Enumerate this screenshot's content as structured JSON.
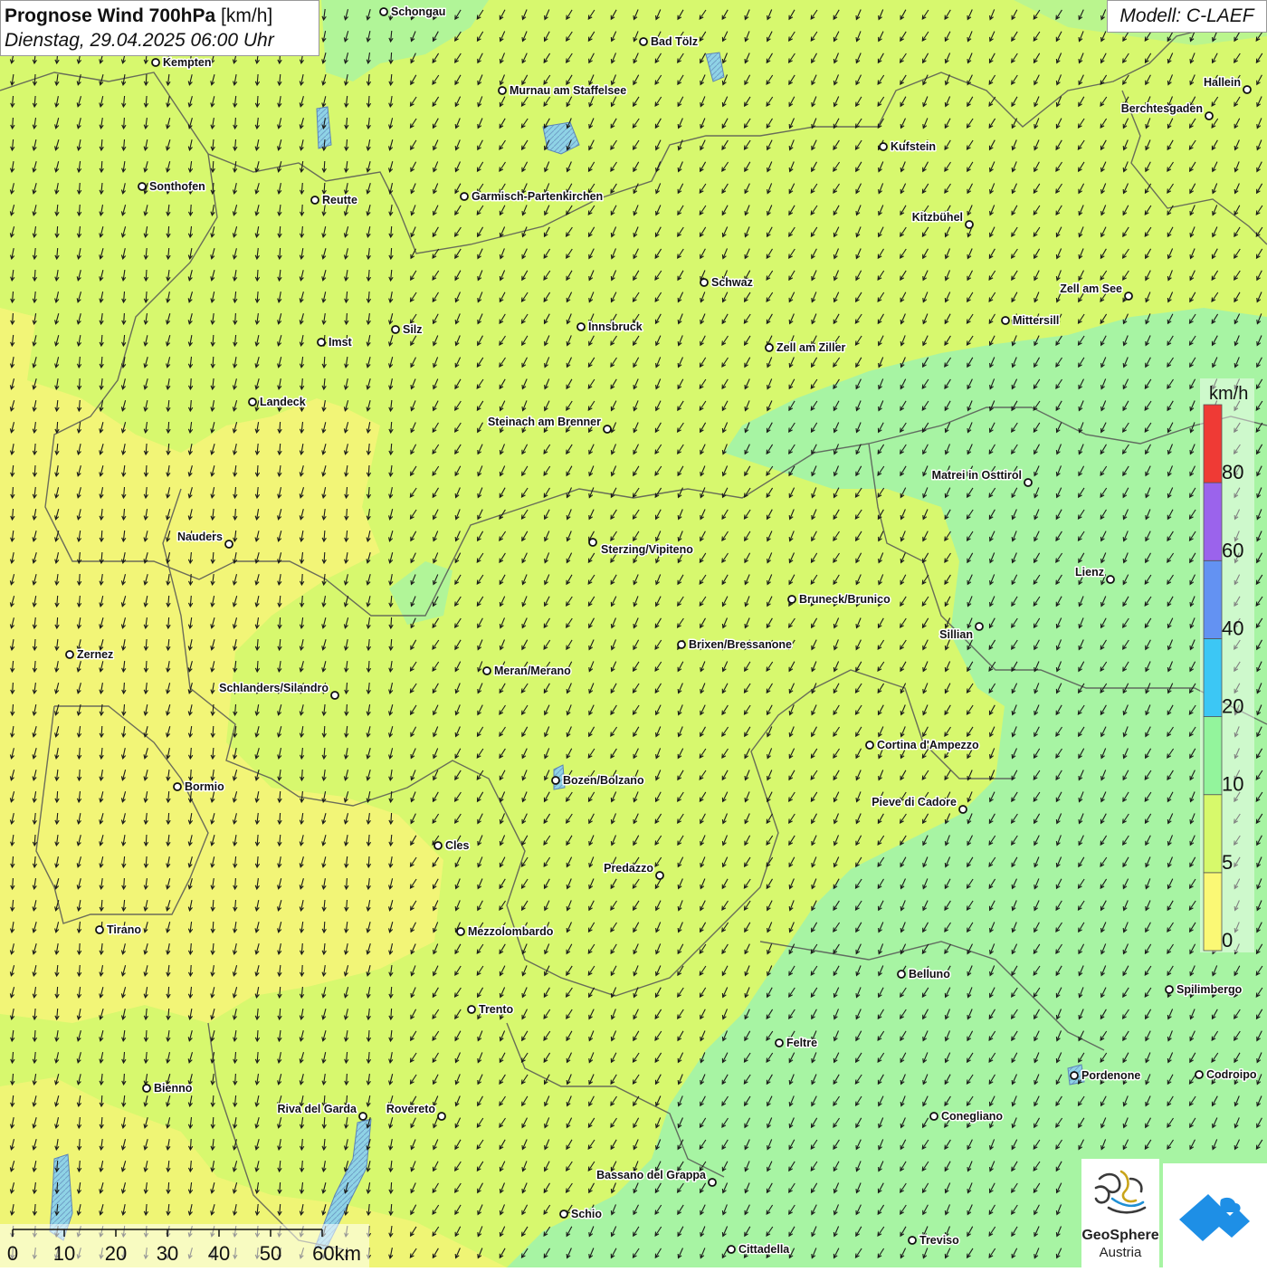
{
  "header": {
    "title": "Prognose Wind 700hPa",
    "unit": "[km/h]",
    "datetime": "Dienstag, 29.04.2025 06:00 Uhr",
    "model": "Modell: C-LAEF"
  },
  "legend": {
    "unit": "km/h",
    "labels": [
      "0",
      "5",
      "10",
      "20",
      "40",
      "60",
      "80"
    ],
    "colors": [
      "#fbf875",
      "#d7f96b",
      "#93f59c",
      "#3cc7f5",
      "#6392f2",
      "#9b63ec",
      "#ef3a35"
    ]
  },
  "colors": {
    "zone_yellow": "#f3f477",
    "zone_lime": "#d7f86e",
    "zone_green": "#a7f4a3",
    "border": "#555555",
    "lake": "#8fd3e6"
  },
  "wind": {
    "direction": "from north-northeast",
    "arrow_icon": "wind-arrow-icon"
  },
  "scalebar": {
    "labels": [
      "0",
      "10",
      "20",
      "30",
      "40",
      "50",
      "60km"
    ]
  },
  "places": [
    {
      "name": "Schongau"
    },
    {
      "name": "Bad Tölz"
    },
    {
      "name": "Kempten"
    },
    {
      "name": "Murnau am Staffelsee"
    },
    {
      "name": "Hallein"
    },
    {
      "name": "Berchtesgaden"
    },
    {
      "name": "Kufstein"
    },
    {
      "name": "Sonthofen"
    },
    {
      "name": "Reutte"
    },
    {
      "name": "Garmisch-Partenkirchen"
    },
    {
      "name": "Kitzbühel"
    },
    {
      "name": "Schwaz"
    },
    {
      "name": "Zell am See"
    },
    {
      "name": "Mittersill"
    },
    {
      "name": "Innsbruck"
    },
    {
      "name": "Silz"
    },
    {
      "name": "Imst"
    },
    {
      "name": "Zell am Ziller"
    },
    {
      "name": "Landeck"
    },
    {
      "name": "Steinach am Brenner"
    },
    {
      "name": "Matrei in Osttirol"
    },
    {
      "name": "Nauders"
    },
    {
      "name": "Sterzing/Vipiteno"
    },
    {
      "name": "Lienz"
    },
    {
      "name": "Bruneck/Brunico"
    },
    {
      "name": "Sillian"
    },
    {
      "name": "Brixen/Bressanone"
    },
    {
      "name": "Zernez"
    },
    {
      "name": "Meran/Merano"
    },
    {
      "name": "Schlanders/Silandro"
    },
    {
      "name": "Cortina d'Ampezzo"
    },
    {
      "name": "Bormio"
    },
    {
      "name": "Bozen/Bolzano"
    },
    {
      "name": "Pieve di Cadore"
    },
    {
      "name": "Cles"
    },
    {
      "name": "Predazzo"
    },
    {
      "name": "Tirano"
    },
    {
      "name": "Mezzolombardo"
    },
    {
      "name": "Belluno"
    },
    {
      "name": "Spilimbergo"
    },
    {
      "name": "Trento"
    },
    {
      "name": "Feltre"
    },
    {
      "name": "Pordenone"
    },
    {
      "name": "Codroipo"
    },
    {
      "name": "Bienno"
    },
    {
      "name": "Riva del Garda"
    },
    {
      "name": "Rovereto"
    },
    {
      "name": "Conegliano"
    },
    {
      "name": "Bassano del Grappa"
    },
    {
      "name": "Schio"
    },
    {
      "name": "Treviso"
    },
    {
      "name": "Cittadella"
    }
  ],
  "logos": {
    "org_name": "GeoSphere",
    "org_sub": "Austria"
  }
}
